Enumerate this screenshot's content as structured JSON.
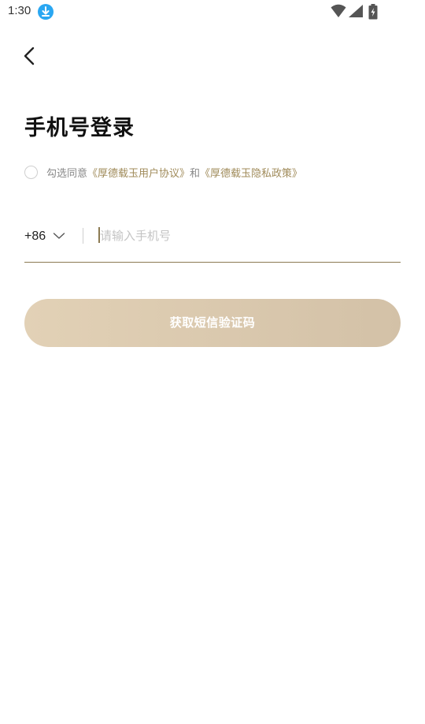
{
  "status_bar": {
    "time": "1:30",
    "icons": [
      "download-icon",
      "wifi-icon",
      "signal-icon",
      "battery-charging-icon"
    ]
  },
  "header": {
    "back_icon": "chevron-left-icon"
  },
  "page": {
    "title": "手机号登录"
  },
  "agreement": {
    "prefix": "勾选同意",
    "user_agreement": "《厚德载玉用户协议》",
    "connector": "和",
    "privacy_policy": "《厚德载玉隐私政策》",
    "checked": false
  },
  "phone": {
    "country_code": "+86",
    "value": "",
    "placeholder": "请输入手机号"
  },
  "actions": {
    "get_code_label": "获取短信验证码",
    "button_gradient": [
      "#e2d1b6",
      "#d3c1a7"
    ]
  },
  "colors": {
    "accent": "#a08b5a",
    "underline": "#8c7a52",
    "download_badge": "#2aa7f2"
  }
}
